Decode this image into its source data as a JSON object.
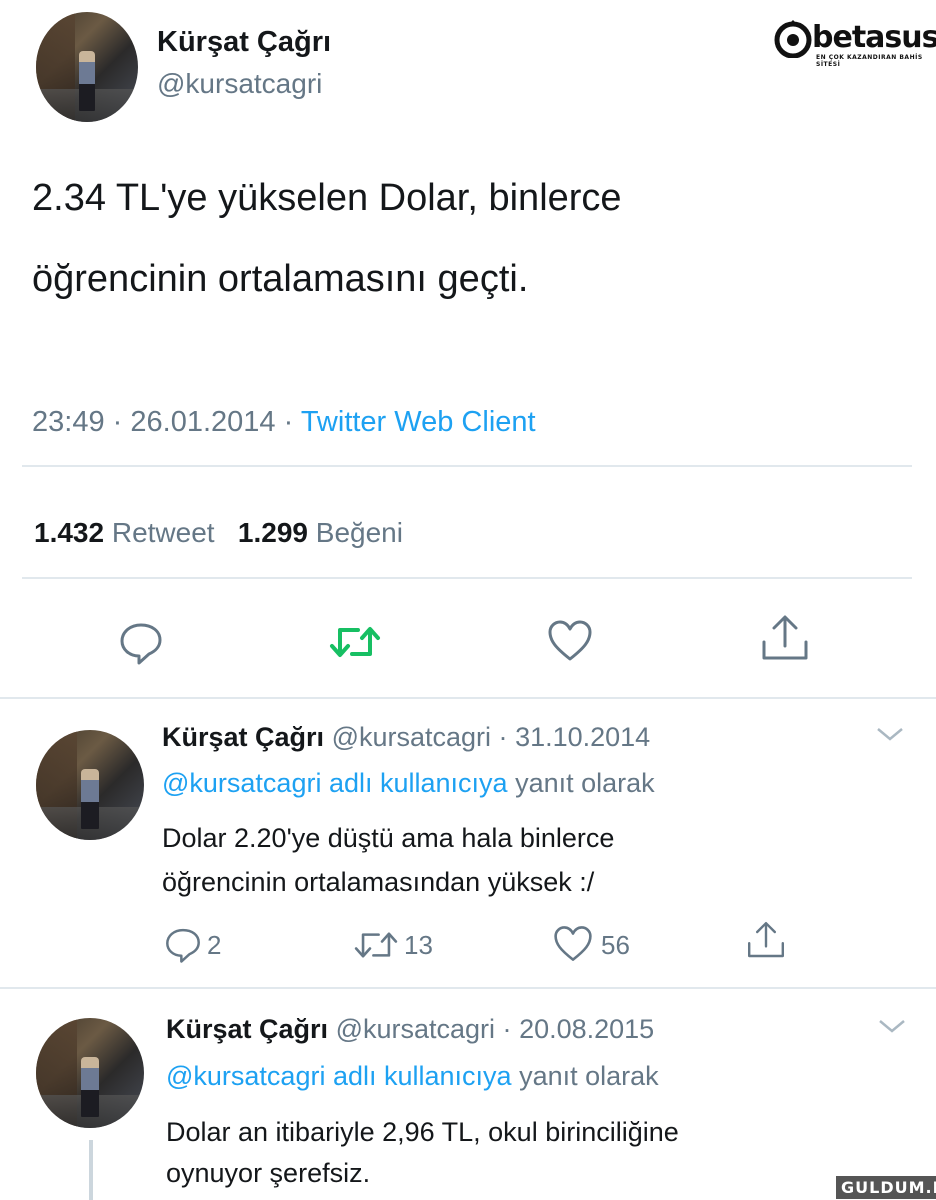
{
  "main_tweet": {
    "display_name": "Kürşat Çağrı",
    "handle": "@kursatcagri",
    "text_line1": "2.34 TL'ye yükselen Dolar, binlerce",
    "text_line2": "öğrencinin ortalamasını geçti.",
    "time": "23:49",
    "date": "26.01.2014",
    "separator": "·",
    "client": "Twitter Web Client",
    "retweet_count": "1.432",
    "retweet_label": "Retweet",
    "like_count": "1.299",
    "like_label": "Beğeni"
  },
  "replies": [
    {
      "display_name": "Kürşat Çağrı",
      "handle": "@kursatcagri",
      "date_sep": "·",
      "date": "31.10.2014",
      "reply_to_user": "@kursatcagri adlı kullanıcıya",
      "reply_to_suffix": "yanıt olarak",
      "text_line1": "Dolar 2.20'ye düştü ama hala binlerce",
      "text_line2": "öğrencinin ortalamasından yüksek :/",
      "reply_count": "2",
      "retweet_count": "13",
      "like_count": "56"
    },
    {
      "display_name": "Kürşat Çağrı",
      "handle": "@kursatcagri",
      "date_sep": "·",
      "date": "20.08.2015",
      "reply_to_user": "@kursatcagri adlı kullanıcıya",
      "reply_to_suffix": "yanıt olarak",
      "text_line1": "Dolar an itibariyle 2,96 TL, okul birinciliğine",
      "text_line2": "oynuyor şerefsiz."
    }
  ],
  "branding": {
    "logo_text": "betasus",
    "logo_tagline": "EN ÇOK KAZANDIRAN BAHİS SİTESİ",
    "watermark": "GULDUM.NET"
  },
  "colors": {
    "accent": "#1da1f2",
    "retweet_green": "#17bf63",
    "muted": "#657786",
    "text": "#14171a"
  }
}
